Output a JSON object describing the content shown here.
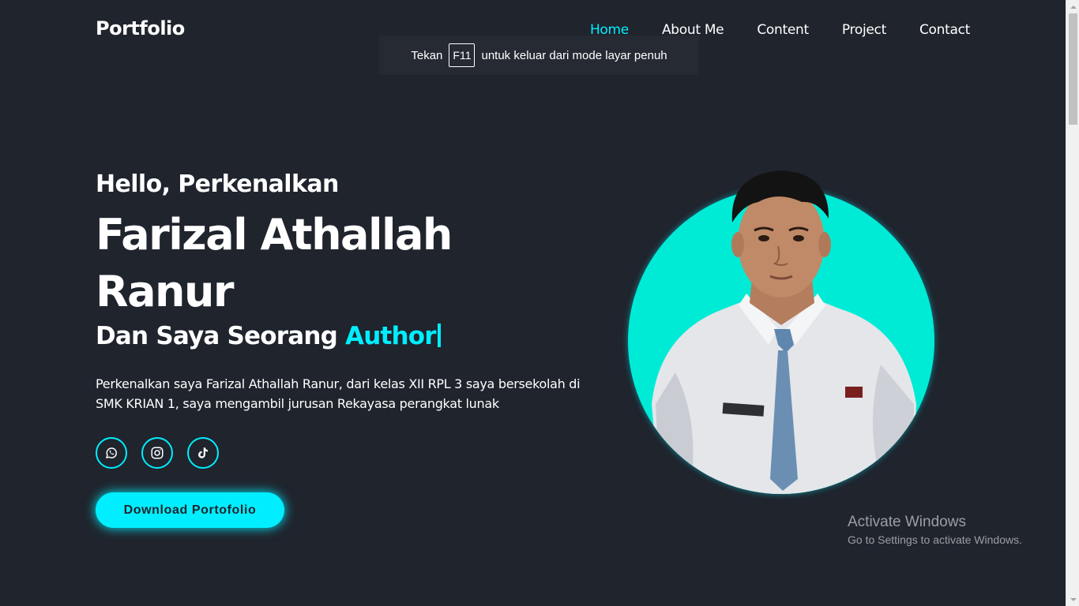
{
  "header": {
    "logo": "Portfolio",
    "nav": [
      {
        "label": "Home"
      },
      {
        "label": "About Me"
      },
      {
        "label": "Content"
      },
      {
        "label": "Project"
      },
      {
        "label": "Contact"
      }
    ]
  },
  "toast": {
    "prefix": "Tekan",
    "key": "F11",
    "suffix": "untuk keluar dari mode layar penuh"
  },
  "hero": {
    "greeting": "Hello, Perkenalkan",
    "name": "Farizal Athallah Ranur",
    "role_prefix": "Dan Saya Seorang",
    "role_highlight": "Author",
    "description": "Perkenalkan saya Farizal Athallah Ranur, dari kelas XII RPL 3 saya bersekolah di SMK KRIAN 1, saya mengambil jurusan Rekayasa perangkat lunak",
    "socials": [
      {
        "icon": "whatsapp-icon"
      },
      {
        "icon": "instagram-icon"
      },
      {
        "icon": "tiktok-icon"
      }
    ],
    "button_label": "Download Portofolio"
  },
  "watermark": {
    "title": "Activate Windows",
    "subtitle": "Go to Settings to activate Windows."
  },
  "colors": {
    "background": "#1f242d",
    "accent": "#00eeff",
    "photo_circle": "#00ebd5"
  }
}
